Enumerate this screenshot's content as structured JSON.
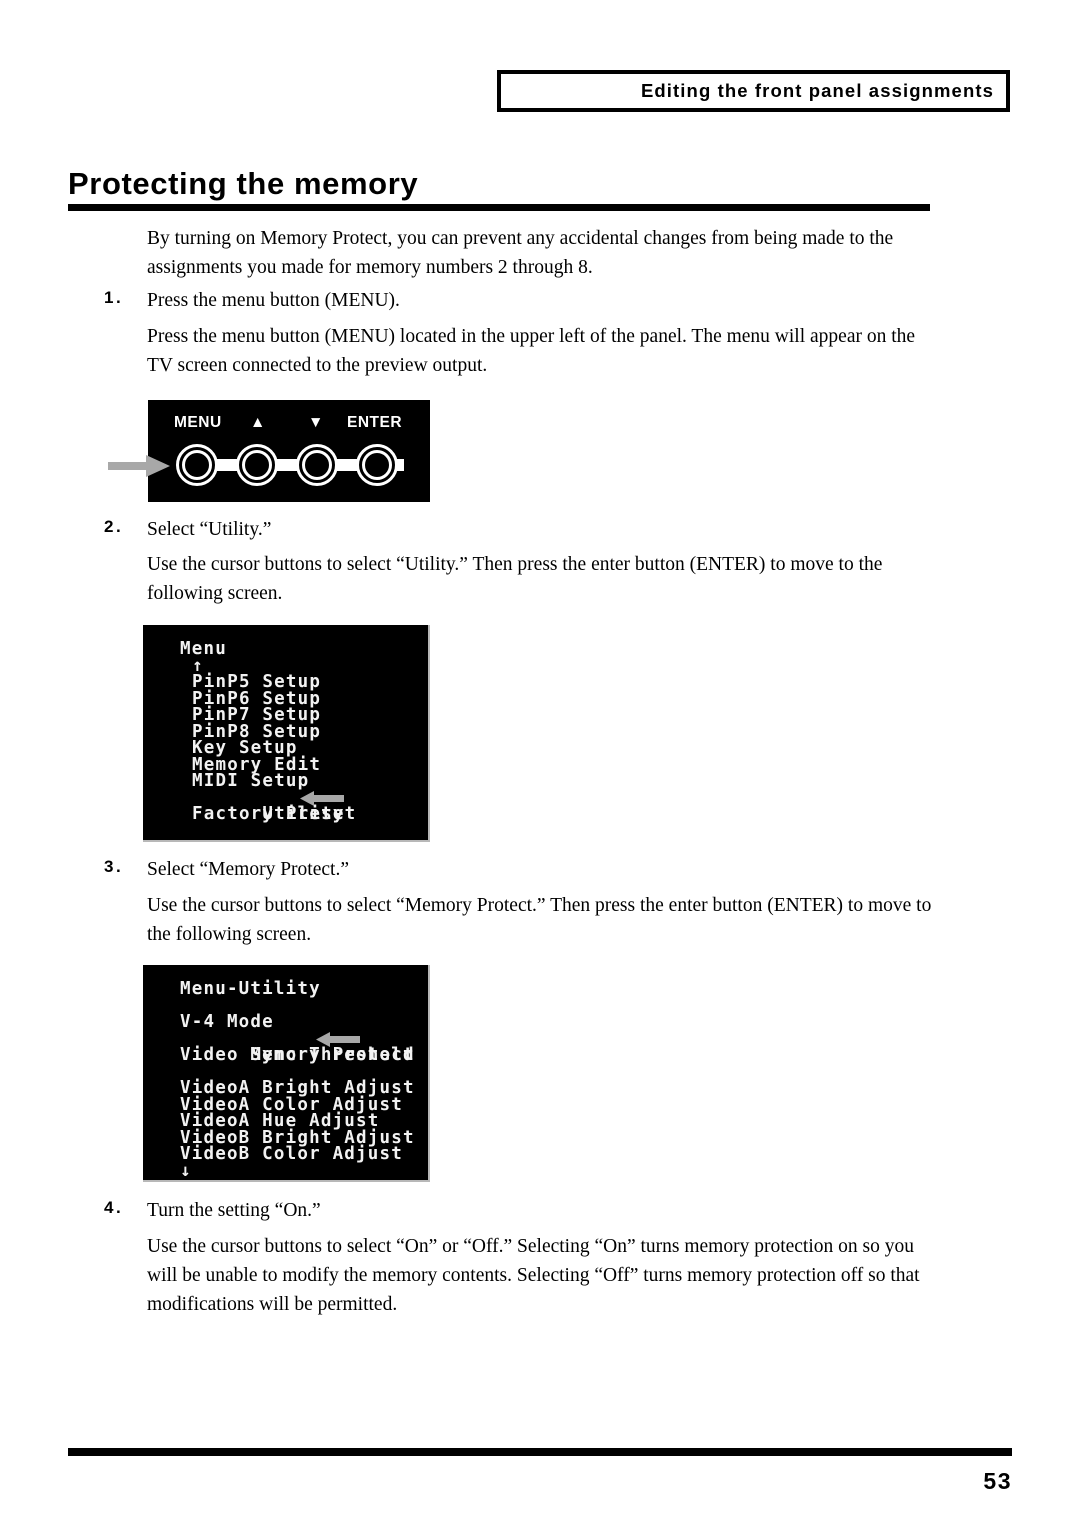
{
  "header": {
    "running_title": "Editing the front panel assignments"
  },
  "title": "Protecting the memory",
  "intro": "By turning on Memory Protect, you can prevent any accidental changes from being made to the assignments you made for memory numbers 2 through 8.",
  "steps": [
    {
      "number": "1.",
      "heading": "Press the menu button (MENU).",
      "body": "Press the menu button (MENU) located in the upper left of the panel. The menu will appear on the TV screen connected to the preview output."
    },
    {
      "number": "2.",
      "heading": "Select “Utility.”",
      "body": "Use the cursor buttons to select “Utility.” Then press the enter button (ENTER) to move to the following screen."
    },
    {
      "number": "3.",
      "heading": "Select “Memory Protect.”",
      "body": "Use the cursor buttons to select “Memory Protect.” Then press the enter button (ENTER) to move to the following screen."
    },
    {
      "number": "4.",
      "heading": "Turn the setting “On.”",
      "body": "Use the cursor buttons to select “On” or “Off.” Selecting “On” turns memory protection on so you will be unable to modify the memory contents. Selecting “Off” turns memory protection off so that modifications will be permitted."
    }
  ],
  "panel_figure": {
    "labels": [
      "MENU",
      "▲",
      "▼",
      "ENTER"
    ],
    "pointer_target": "MENU",
    "pointer_color": "#a8a8a8",
    "background_color": "#000000",
    "button_color": "#ffffff"
  },
  "lcd_menu": {
    "title": "Menu",
    "scroll_up": "↑",
    "items": [
      "PinP5 Setup",
      "PinP6 Setup",
      "PinP7 Setup",
      "PinP8 Setup",
      "Key Setup",
      "Memory Edit",
      "MIDI Setup",
      "Utility",
      "Factory Preset"
    ],
    "selected": "Utility",
    "text_color": "#f2f2f2",
    "background_color": "#000000",
    "pointer_color": "#a8a8a8"
  },
  "lcd_utility": {
    "title": "Menu-Utility",
    "items": [
      "V-4 Mode",
      "Memory Protect",
      "Video Sync Threshold",
      "",
      "VideoA Bright Adjust",
      "VideoA Color Adjust",
      "VideoA Hue Adjust",
      "VideoB Bright Adjust",
      "VideoB Color Adjust"
    ],
    "selected": "Memory Protect",
    "scroll_down": "↓",
    "text_color": "#f2f2f2",
    "background_color": "#000000",
    "pointer_color": "#a8a8a8"
  },
  "footer": {
    "page_number": "53"
  }
}
